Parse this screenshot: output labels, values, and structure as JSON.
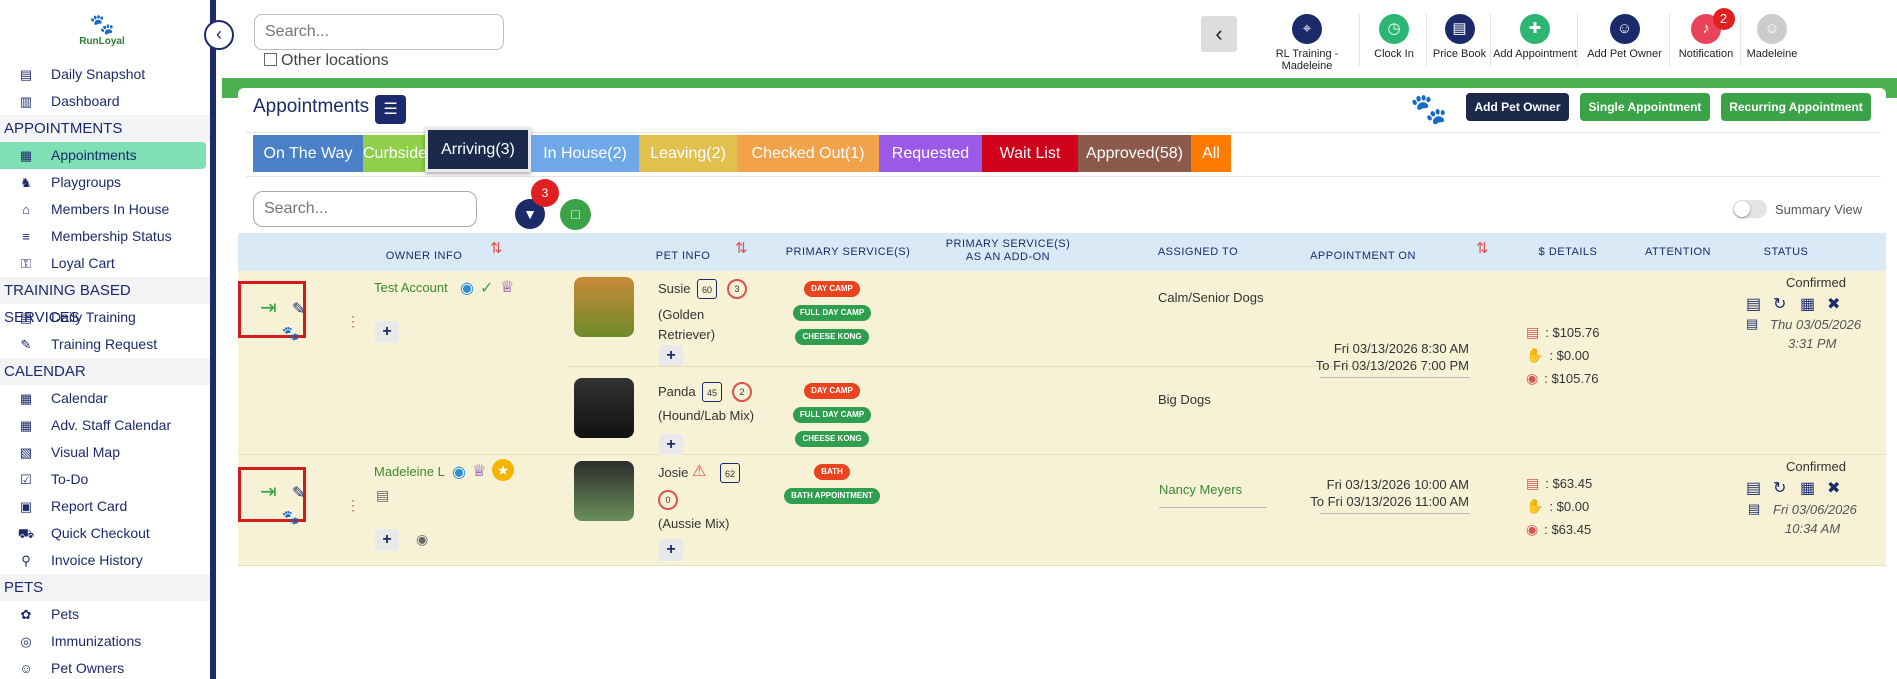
{
  "sidebar": {
    "logo": "RunLoyal",
    "sections": [
      {
        "type": "item",
        "label": "Daily Snapshot",
        "icon": "today-icon"
      },
      {
        "type": "item",
        "label": "Dashboard",
        "icon": "dashboard-icon"
      },
      {
        "type": "section",
        "label": "APPOINTMENTS"
      },
      {
        "type": "item",
        "label": "Appointments",
        "icon": "calendar-icon",
        "active": true
      },
      {
        "type": "item",
        "label": "Playgroups",
        "icon": "dog-icon"
      },
      {
        "type": "item",
        "label": "Members In House",
        "icon": "house-icon"
      },
      {
        "type": "item",
        "label": "Membership Status",
        "icon": "status-icon"
      },
      {
        "type": "item",
        "label": "Loyal Cart",
        "icon": "cart-icon"
      },
      {
        "type": "section",
        "label": "TRAINING BASED SERVICES"
      },
      {
        "type": "item",
        "label": "Daily Training",
        "icon": "today-icon"
      },
      {
        "type": "item",
        "label": "Training Request",
        "icon": "request-icon"
      },
      {
        "type": "section",
        "label": "CALENDAR"
      },
      {
        "type": "item",
        "label": "Calendar",
        "icon": "calendar-icon"
      },
      {
        "type": "item",
        "label": "Adv. Staff Calendar",
        "icon": "staff-calendar-icon"
      },
      {
        "type": "item",
        "label": "Visual Map",
        "icon": "map-icon"
      },
      {
        "type": "item",
        "label": "To-Do",
        "icon": "todo-icon"
      },
      {
        "type": "item",
        "label": "Report Card",
        "icon": "report-card-icon"
      },
      {
        "type": "item",
        "label": "Quick Checkout",
        "icon": "checkout-icon"
      },
      {
        "type": "item",
        "label": "Invoice History",
        "icon": "invoice-icon"
      },
      {
        "type": "section",
        "label": "PETS"
      },
      {
        "type": "item",
        "label": "Pets",
        "icon": "paw-icon"
      },
      {
        "type": "item",
        "label": "Immunizations",
        "icon": "immunization-icon"
      },
      {
        "type": "item",
        "label": "Pet Owners",
        "icon": "person-icon"
      }
    ]
  },
  "header": {
    "search_placeholder": "Search...",
    "other_locations": "Other locations",
    "tools": [
      {
        "label": "RL Training - Madeleine",
        "icon": "location-pin-icon",
        "color": "#1b2a6b"
      },
      {
        "label": "Clock In",
        "icon": "clock-icon",
        "color": "#2bb673"
      },
      {
        "label": "Price Book",
        "icon": "price-book-icon",
        "color": "#1b2a6b"
      },
      {
        "label": "Add Appointment",
        "icon": "add-appointment-icon",
        "color": "#2bb673"
      },
      {
        "label": "Add Pet Owner",
        "icon": "add-user-icon",
        "color": "#1b2a6b"
      },
      {
        "label": "Notification",
        "icon": "bell-icon",
        "color": "#e9435a",
        "badge": "2"
      },
      {
        "label": "Madeleine",
        "icon": "avatar-icon",
        "color": "#cccccc"
      }
    ]
  },
  "panel": {
    "title": "Appointments",
    "buttons": [
      {
        "label": "Add Pet Owner",
        "color": "#1b2a4a"
      },
      {
        "label": "Single Appointment",
        "color": "#3aa347"
      },
      {
        "label": "Recurring Appointment",
        "color": "#3aa347"
      }
    ],
    "tabs": [
      {
        "label": "On The Way",
        "color": "#4a80c8"
      },
      {
        "label": "Curbside",
        "color": "#8fcf4a"
      },
      {
        "label": "Arriving(3)",
        "color": "#1b2a4a",
        "selected": true
      },
      {
        "label": "In House(2)",
        "color": "#6fa8e8"
      },
      {
        "label": "Leaving(2)",
        "color": "#e2c04e"
      },
      {
        "label": "Checked Out(1)",
        "color": "#f2a24a"
      },
      {
        "label": "Requested",
        "color": "#9b59e8"
      },
      {
        "label": "Wait List",
        "color": "#d0021b"
      },
      {
        "label": "Approved(58)",
        "color": "#8b5a4a"
      },
      {
        "label": "All",
        "color": "#ff7a00"
      }
    ],
    "list_search_placeholder": "Search...",
    "filter_badge": "3",
    "summary_view": "Summary View",
    "columns": {
      "owner": "OWNER INFO",
      "pet": "PET INFO",
      "primary": "PRIMARY SERVICE(S)",
      "addon": "PRIMARY SERVICE(S) AS AN ADD-ON",
      "assigned": "ASSIGNED TO",
      "appt": "APPOINTMENT ON",
      "details": "$ DETAILS",
      "attention": "ATTENTION",
      "status": "STATUS"
    }
  },
  "rows": [
    {
      "owner": "Test Account",
      "pets": [
        {
          "name": "Susie",
          "weight": "60",
          "count": "3",
          "breed": "(Golden Retriever)",
          "services": [
            {
              "label": "DAY CAMP",
              "c": "red"
            },
            {
              "label": "FULL DAY CAMP",
              "c": "green"
            },
            {
              "label": "CHEESE KONG",
              "c": "green"
            }
          ],
          "assigned": "Calm/Senior Dogs"
        },
        {
          "name": "Panda",
          "weight": "45",
          "count": "2",
          "breed": "(Hound/Lab Mix)",
          "services": [
            {
              "label": "DAY CAMP",
              "c": "red"
            },
            {
              "label": "FULL DAY CAMP",
              "c": "green"
            },
            {
              "label": "CHEESE KONG",
              "c": "green"
            }
          ],
          "assigned": "Big Dogs"
        }
      ],
      "appt_from": "Fri 03/13/2026 8:30 AM",
      "appt_to": "To Fri 03/13/2026 7:00 PM",
      "total": ": $105.76",
      "paid": ": $0.00",
      "due": ": $105.76",
      "status": "Confirmed",
      "status_date": "Thu 03/05/2026",
      "status_time": "3:31 PM"
    },
    {
      "owner": "Madeleine L",
      "pets": [
        {
          "name": "Josie",
          "weight": "62",
          "count": "0",
          "breed": "(Aussie Mix)",
          "services": [
            {
              "label": "BATH",
              "c": "red"
            },
            {
              "label": "BATH APPOINTMENT",
              "c": "green"
            }
          ],
          "assigned": "Nancy Meyers"
        }
      ],
      "appt_from": "Fri 03/13/2026 10:00 AM",
      "appt_to": "To Fri 03/13/2026 11:00 AM",
      "total": ": $63.45",
      "paid": ": $0.00",
      "due": ": $63.45",
      "status": "Confirmed",
      "status_date": "Fri 03/06/2026",
      "status_time": "10:34 AM"
    }
  ]
}
